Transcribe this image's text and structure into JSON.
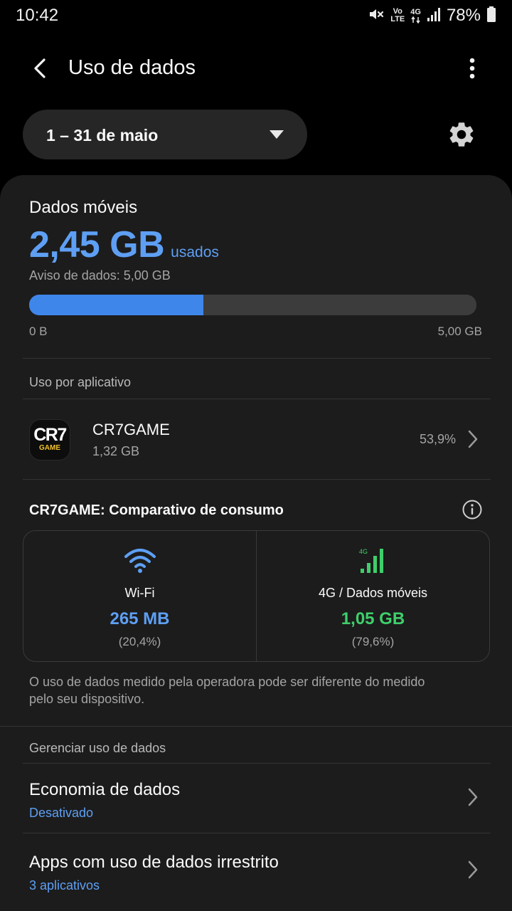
{
  "status_bar": {
    "time": "10:42",
    "icons": [
      "mute-icon",
      "volte-icon",
      "network-4g-icon",
      "signal-icon",
      "battery-icon"
    ],
    "volte_line1": "Vo",
    "volte_line2": "LTE",
    "network": "4G",
    "battery": "78%"
  },
  "app_bar": {
    "title": "Uso de dados",
    "back_icon": "back-arrow-icon",
    "menu_icon": "more-vert-icon"
  },
  "period": {
    "label": "1 – 31 de maio",
    "settings_icon": "gear-icon"
  },
  "mobile_data": {
    "title": "Dados móveis",
    "used_value": "2,45 GB",
    "used_unit": "usados",
    "warning": "Aviso de dados: 5,00 GB",
    "progress_fraction": 0.39,
    "bar_min_label": "0 B",
    "bar_max_label": "5,00 GB"
  },
  "usage_by_app": {
    "section_label": "Uso por aplicativo",
    "apps": [
      {
        "name": "CR7GAME",
        "size": "1,32 GB",
        "percent": "53,9%",
        "icon_text_top": "CR7",
        "icon_text_bottom": "GAME"
      }
    ]
  },
  "comparison": {
    "title": "CR7GAME: Comparativo de consumo",
    "info_icon": "info-icon",
    "wifi": {
      "label": "Wi-Fi",
      "value": "265 MB",
      "percent": "(20,4%)",
      "icon": "wifi-icon"
    },
    "mobile": {
      "label": "4G / Dados móveis",
      "value": "1,05 GB",
      "percent": "(79,6%)",
      "icon": "cellular-4g-icon",
      "icon_badge": "4G"
    }
  },
  "disclaimer": "O uso de dados medido pela operadora pode ser diferente do medido pelo seu dispositivo.",
  "manage": {
    "section_label": "Gerenciar uso de dados",
    "items": [
      {
        "title": "Economia de dados",
        "subtitle": "Desativado"
      },
      {
        "title": "Apps com uso de dados irrestrito",
        "subtitle": "3 aplicativos"
      }
    ]
  },
  "colors": {
    "accent_blue": "#5e9ff4",
    "accent_green": "#3ecf6b",
    "card_bg": "#1c1c1c",
    "background": "#000000"
  }
}
